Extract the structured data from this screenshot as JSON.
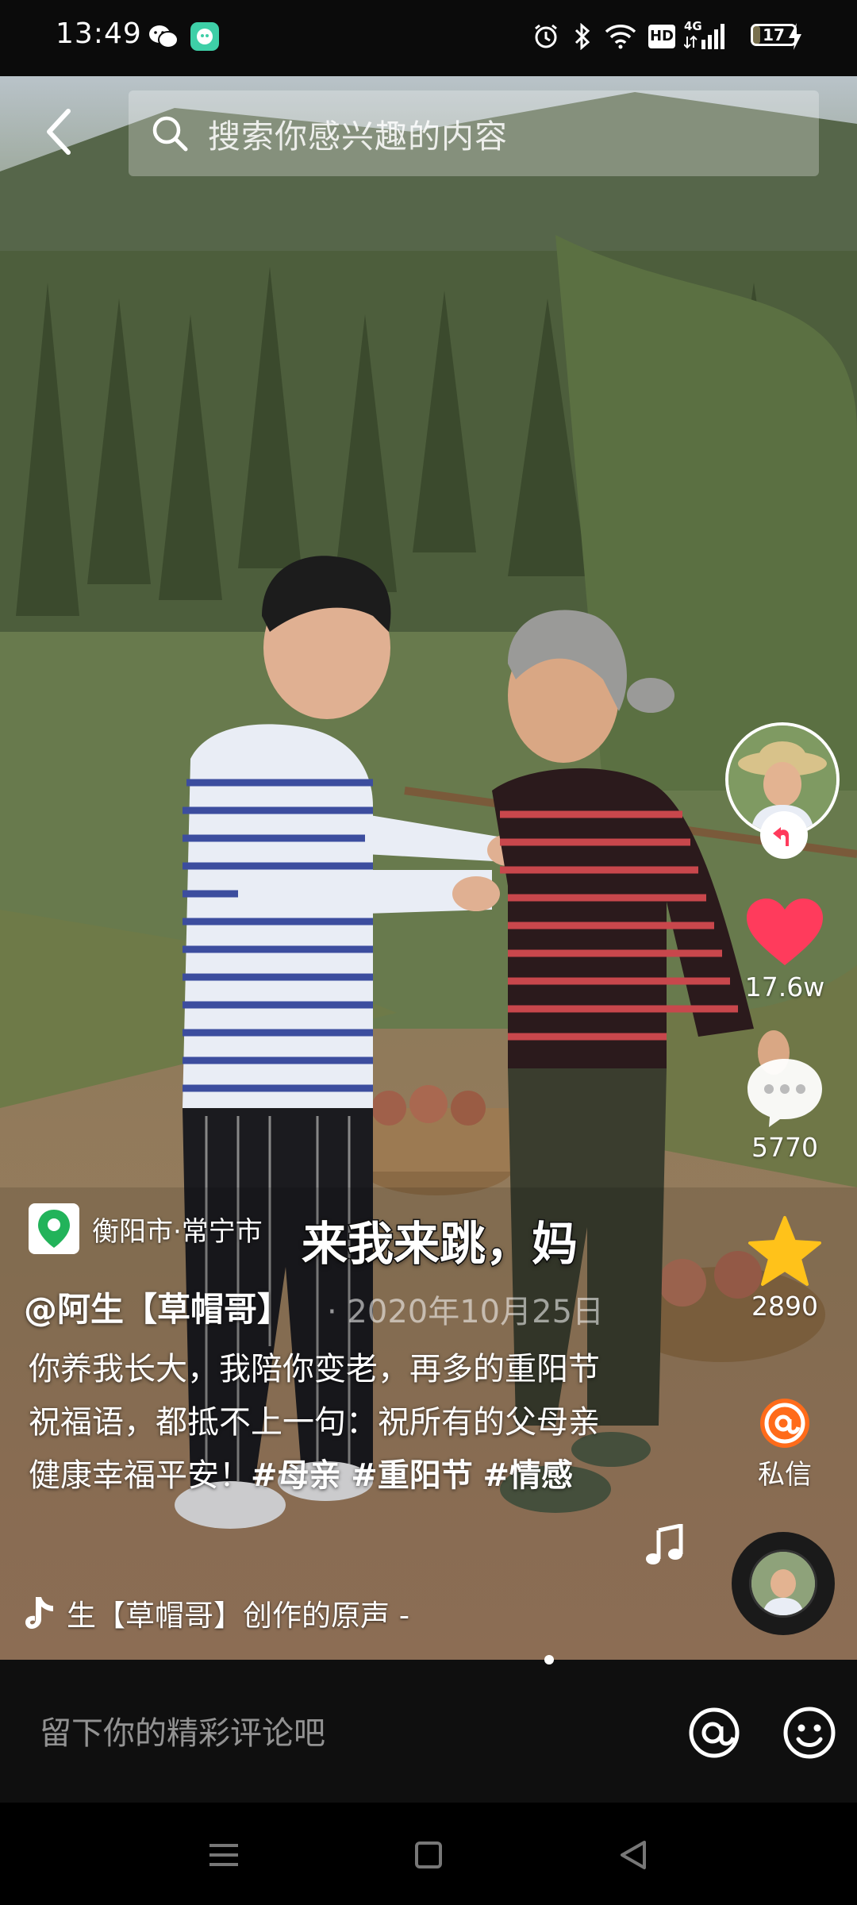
{
  "status_bar": {
    "time": "13:49",
    "network": "4G",
    "hd": "HD",
    "battery_level": "17",
    "icons": [
      "wechat-icon",
      "app-notification-icon",
      "alarm-icon",
      "bluetooth-icon",
      "wifi-icon",
      "hd-icon",
      "signal-icon",
      "battery-icon",
      "charging-icon"
    ]
  },
  "search": {
    "placeholder": "搜索你感兴趣的内容"
  },
  "location": {
    "text": "衡阳市·常宁市"
  },
  "video": {
    "subtitle": "来我来跳，妈"
  },
  "author": {
    "name": "@阿生【草帽哥】",
    "date": "· 2020年10月25日"
  },
  "caption": {
    "text": "你养我长大，我陪你变老，再多的重阳节祝福语，都抵不上一句：祝所有的父母亲健康幸福平安！",
    "tags": [
      "#母亲",
      "#重阳节",
      "#情感"
    ]
  },
  "music": {
    "text": "生【草帽哥】创作的原声 -"
  },
  "actions": {
    "likes": "17.6w",
    "comments": "5770",
    "favorites": "2890",
    "message_label": "私信"
  },
  "comment_bar": {
    "placeholder": "留下你的精彩评论吧"
  },
  "colors": {
    "like": "#ff3b5c",
    "favorite": "#ffc21a",
    "location_pin": "#22b35a",
    "message_badge": "#ff6b1a"
  }
}
